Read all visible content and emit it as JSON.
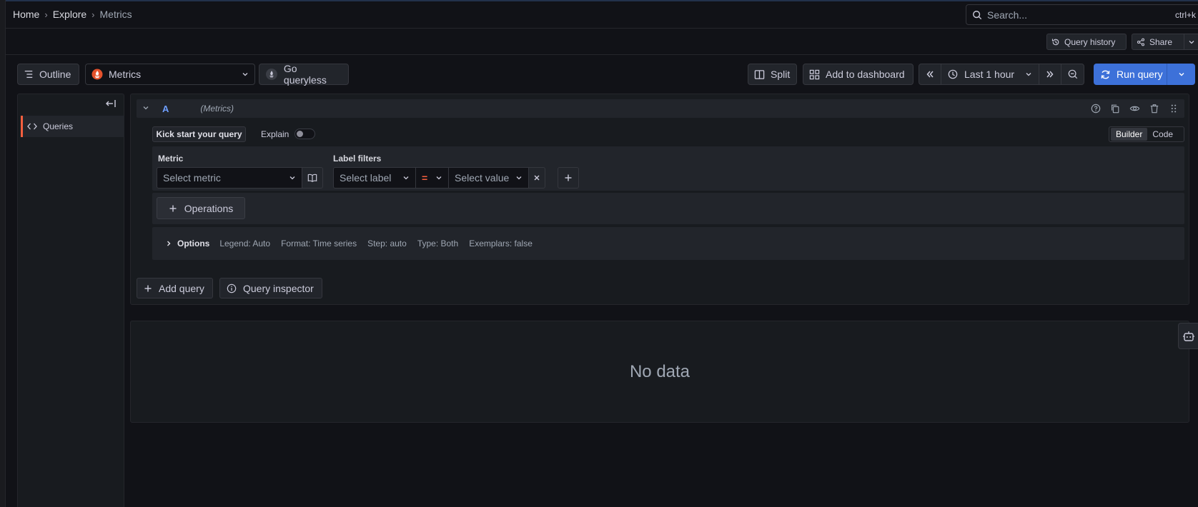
{
  "breadcrumbs": [
    "Home",
    "Explore",
    "Metrics"
  ],
  "search": {
    "placeholder": "Search...",
    "shortcut": "ctrl+k"
  },
  "secondary_toolbar": {
    "query_history": "Query history",
    "share": "Share"
  },
  "toolbar": {
    "outline": "Outline",
    "datasource": "Metrics",
    "go_queryless": "Go queryless",
    "split": "Split",
    "add_to_dashboard": "Add to dashboard",
    "time_range": "Last 1 hour",
    "run_query": "Run query"
  },
  "sidebar": {
    "items": [
      {
        "label": "Queries",
        "active": true
      }
    ]
  },
  "query": {
    "ref_id": "A",
    "datasource_label": "(Metrics)",
    "kick_start": "Kick start your query",
    "explain_label": "Explain",
    "explain_enabled": false,
    "modes": [
      "Builder",
      "Code"
    ],
    "active_mode": "Builder",
    "metric_label": "Metric",
    "metric_placeholder": "Select metric",
    "label_filters_label": "Label filters",
    "label_placeholder": "Select label",
    "operator": "=",
    "value_placeholder": "Select value",
    "operations_label": "Operations",
    "options": {
      "title": "Options",
      "legend": "Legend: Auto",
      "format": "Format: Time series",
      "step": "Step: auto",
      "type": "Type: Both",
      "exemplars": "Exemplars: false"
    }
  },
  "actions": {
    "add_query": "Add query",
    "query_inspector": "Query inspector"
  },
  "result": {
    "empty_text": "No data"
  },
  "colors": {
    "accent": "#3d71d9",
    "brand_orange": "#f55f3e",
    "ref_id": "#6e9fff",
    "background": "#111217",
    "panel": "#181b1f"
  }
}
